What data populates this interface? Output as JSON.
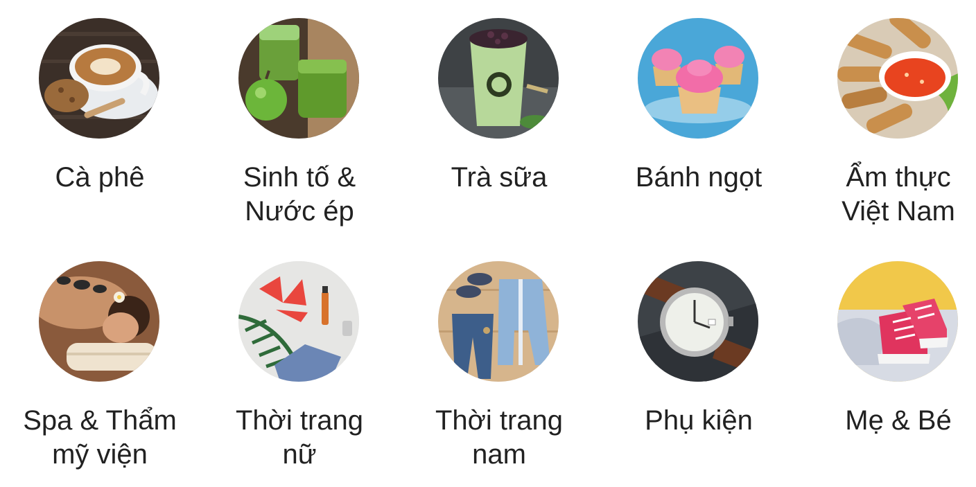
{
  "categories": [
    {
      "label": "Cà phê",
      "icon": "coffee-cup-icon"
    },
    {
      "label": "Sinh tố &\nNước ép",
      "icon": "smoothie-juice-icon"
    },
    {
      "label": "Trà sữa",
      "icon": "milk-tea-icon"
    },
    {
      "label": "Bánh ngọt",
      "icon": "cupcake-icon"
    },
    {
      "label": "Ẩm thực\nViệt Nam",
      "icon": "spring-rolls-icon"
    },
    {
      "label": "Spa & Thẩm\nmỹ viện",
      "icon": "spa-stones-icon"
    },
    {
      "label": "Thời trang\nnữ",
      "icon": "womens-fashion-icon"
    },
    {
      "label": "Thời trang\nnam",
      "icon": "mens-fashion-icon"
    },
    {
      "label": "Phụ kiện",
      "icon": "wristwatch-icon"
    },
    {
      "label": "Mẹ & Bé",
      "icon": "baby-shoes-icon"
    }
  ],
  "colors": {
    "label_text": "#212121",
    "background": "#ffffff"
  }
}
